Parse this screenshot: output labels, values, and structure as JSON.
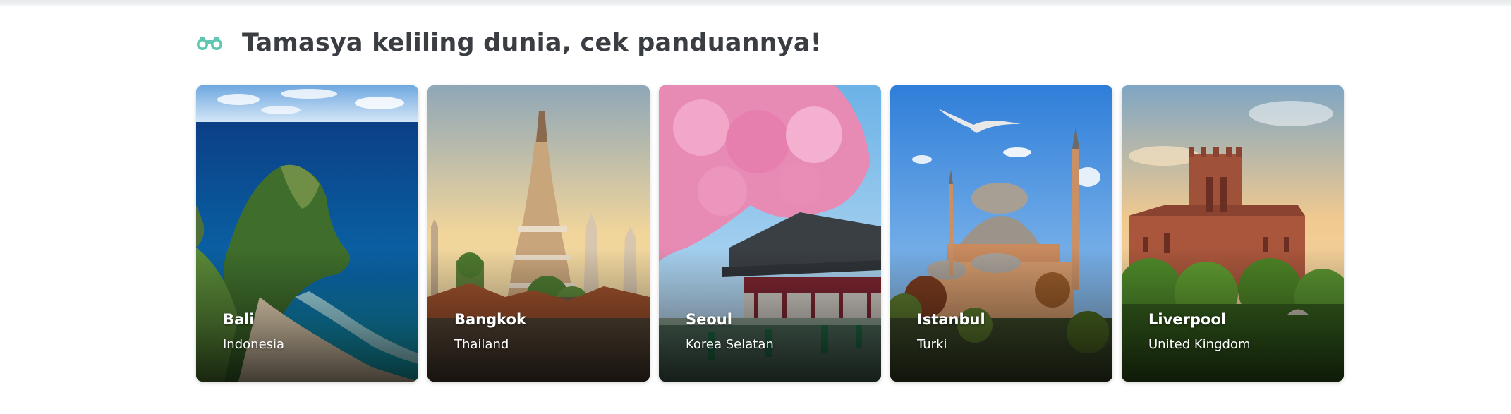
{
  "section": {
    "icon": "binoculars-icon",
    "title": "Tamasya keliling dunia, cek panduannya!"
  },
  "colors": {
    "accent": "#5ec7b2",
    "title_text": "#3a3d42"
  },
  "destinations": [
    {
      "city": "Bali",
      "country": "Indonesia"
    },
    {
      "city": "Bangkok",
      "country": "Thailand"
    },
    {
      "city": "Seoul",
      "country": "Korea Selatan"
    },
    {
      "city": "Istanbul",
      "country": "Turki"
    },
    {
      "city": "Liverpool",
      "country": "United Kingdom"
    }
  ]
}
